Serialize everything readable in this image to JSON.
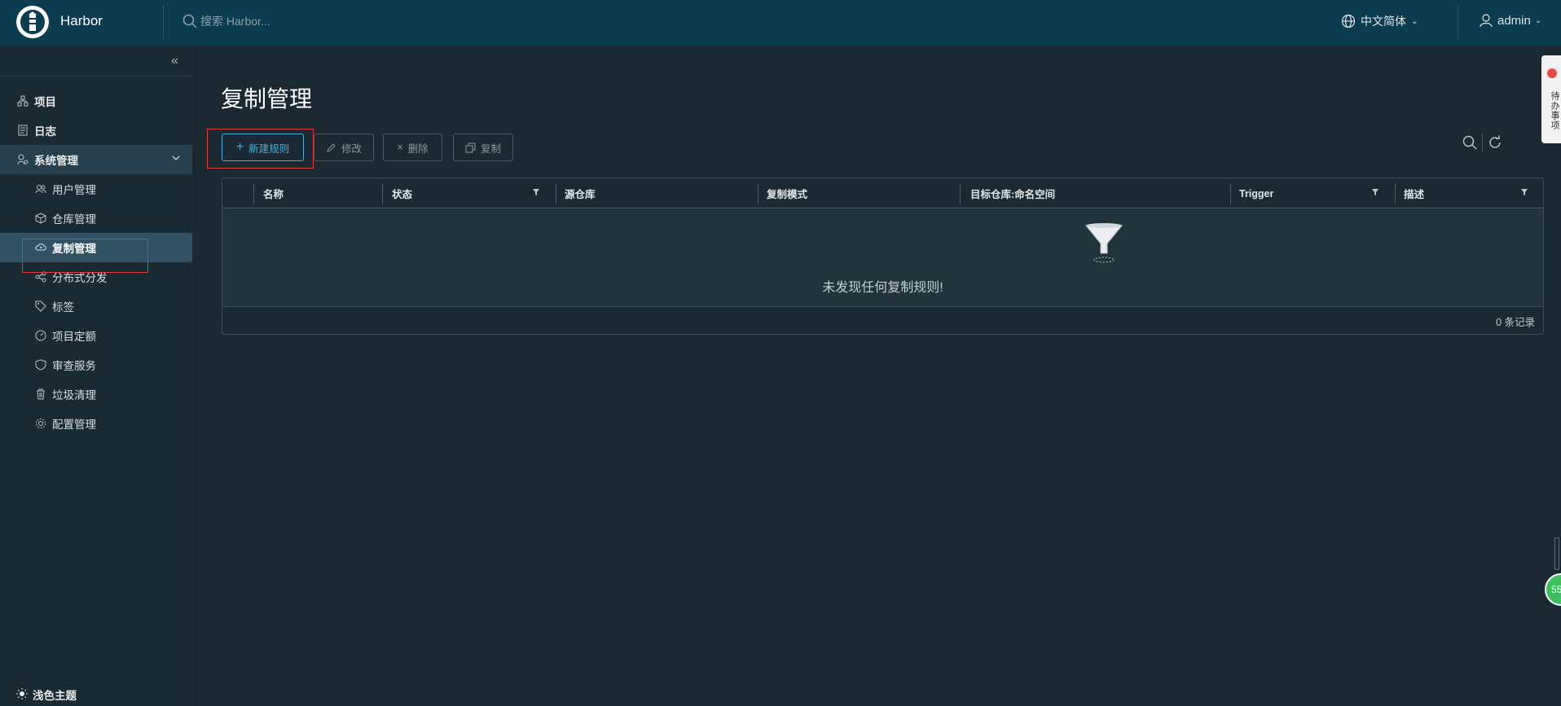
{
  "header": {
    "brand": "Harbor",
    "search_placeholder": "搜索 Harbor...",
    "language": "中文简体",
    "user": "admin"
  },
  "sidebar": {
    "items": [
      {
        "label": "项目",
        "icon": "project-icon"
      },
      {
        "label": "日志",
        "icon": "log-icon"
      },
      {
        "label": "系统管理",
        "icon": "admin-icon"
      }
    ],
    "sub_items": [
      {
        "label": "用户管理",
        "icon": "users-icon"
      },
      {
        "label": "仓库管理",
        "icon": "registry-icon"
      },
      {
        "label": "复制管理",
        "icon": "replication-icon"
      },
      {
        "label": "分布式分发",
        "icon": "distribution-icon"
      },
      {
        "label": "标签",
        "icon": "tag-icon"
      },
      {
        "label": "项目定额",
        "icon": "quota-icon"
      },
      {
        "label": "审查服务",
        "icon": "shield-icon"
      },
      {
        "label": "垃圾清理",
        "icon": "trash-icon"
      },
      {
        "label": "配置管理",
        "icon": "gear-icon"
      }
    ],
    "active": "复制管理",
    "theme_label": "浅色主题"
  },
  "main": {
    "title": "复制管理",
    "buttons": {
      "new_rule": "新建规则",
      "edit": "修改",
      "delete": "删除",
      "copy": "复制"
    },
    "table": {
      "columns": [
        "名称",
        "状态",
        "源仓库",
        "复制模式",
        "目标仓库:命名空间",
        "Trigger",
        "描述"
      ],
      "empty_message": "未发现任何复制规则!",
      "count": "0 条记录"
    }
  },
  "side_tab": {
    "label": "待办事项"
  },
  "float_badge": "55",
  "colors": {
    "header_bg": "#0b3c50",
    "page_bg": "#1b2a32",
    "accent": "#49aed9",
    "highlight": "#e03a3a"
  }
}
